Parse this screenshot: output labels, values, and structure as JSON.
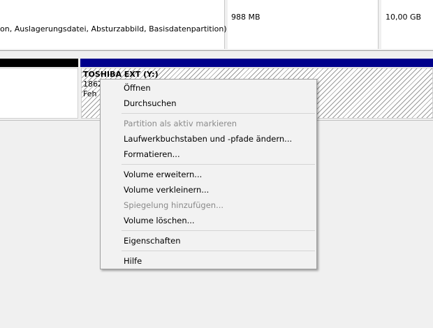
{
  "top_row": {
    "partition_description": "on, Auslagerungsdatei, Absturzabbild, Basisdatenpartition)",
    "size_1": "988 MB",
    "size_2": "10,00 GB"
  },
  "volume": {
    "name": "TOSHIBA EXT  (Y:)",
    "line2": "1862",
    "line3": "Feh"
  },
  "context_menu": {
    "items": [
      {
        "label": "Öffnen",
        "enabled": true
      },
      {
        "label": "Durchsuchen",
        "enabled": true
      },
      {
        "label": "Partition als aktiv markieren",
        "enabled": false
      },
      {
        "label": "Laufwerkbuchstaben und -pfade ändern...",
        "enabled": true
      },
      {
        "label": "Formatieren...",
        "enabled": true
      },
      {
        "label": "Volume erweitern...",
        "enabled": true
      },
      {
        "label": "Volume verkleinern...",
        "enabled": true
      },
      {
        "label": "Spiegelung hinzufügen...",
        "enabled": false
      },
      {
        "label": "Volume löschen...",
        "enabled": true
      },
      {
        "label": "Eigenschaften",
        "enabled": true
      },
      {
        "label": "Hilfe",
        "enabled": true
      }
    ]
  },
  "colors": {
    "basic_disk_bar": "#000000",
    "primary_partition_bar": "#00008b"
  }
}
